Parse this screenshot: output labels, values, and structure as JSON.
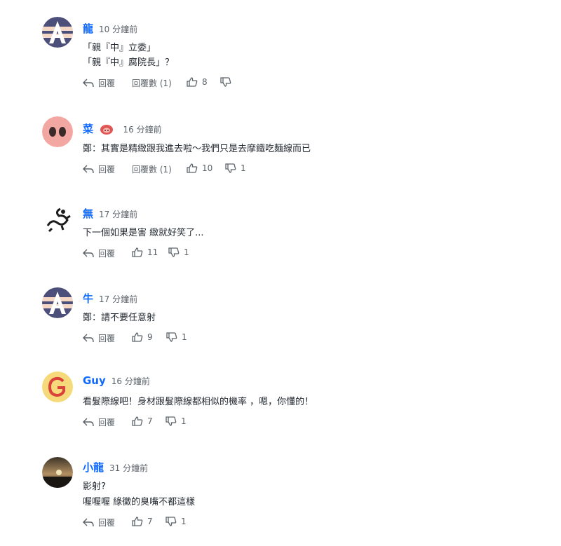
{
  "labels": {
    "reply": "回覆",
    "replies_prefix": "回覆數"
  },
  "comments": [
    {
      "name": "龍",
      "time": "10 分鐘前",
      "lines": [
        "「親『中』立委」",
        "「親『中』腐院長」？"
      ],
      "replies": "(1)",
      "likes": "8",
      "dislikes": "",
      "avatar": "A-logo"
    },
    {
      "name": "菜",
      "time": "16 分鐘前",
      "lines": [
        "鄭：其實是精緻跟我進去啦～我們只是去摩鐵吃麵線而已"
      ],
      "replies": "(1)",
      "likes": "10",
      "dislikes": "1",
      "avatar": "pig-nose",
      "badge": "pig-badge"
    },
    {
      "name": "無",
      "time": "17 分鐘前",
      "lines": [
        "下一個如果是害 緻就好笑了..."
      ],
      "replies": "",
      "likes": "11",
      "dislikes": "1",
      "avatar": "dragon"
    },
    {
      "name": "牛",
      "time": "17 分鐘前",
      "lines": [
        "鄭：請不要任意射"
      ],
      "replies": "",
      "likes": "9",
      "dislikes": "1",
      "avatar": "A-logo"
    },
    {
      "name": "Guy",
      "time": "16 分鐘前",
      "lines": [
        "看髮際線吧！身材跟髮際線都相似的機率 ，嗯，你懂的！"
      ],
      "replies": "",
      "likes": "7",
      "dislikes": "1",
      "avatar": "G-letter"
    },
    {
      "name": "小龍",
      "time": "31 分鐘前",
      "lines": [
        "影射?",
        "喔喔喔 綠黴的臭嘴不都這樣"
      ],
      "replies": "",
      "likes": "7",
      "dislikes": "1",
      "avatar": "sunset"
    }
  ]
}
